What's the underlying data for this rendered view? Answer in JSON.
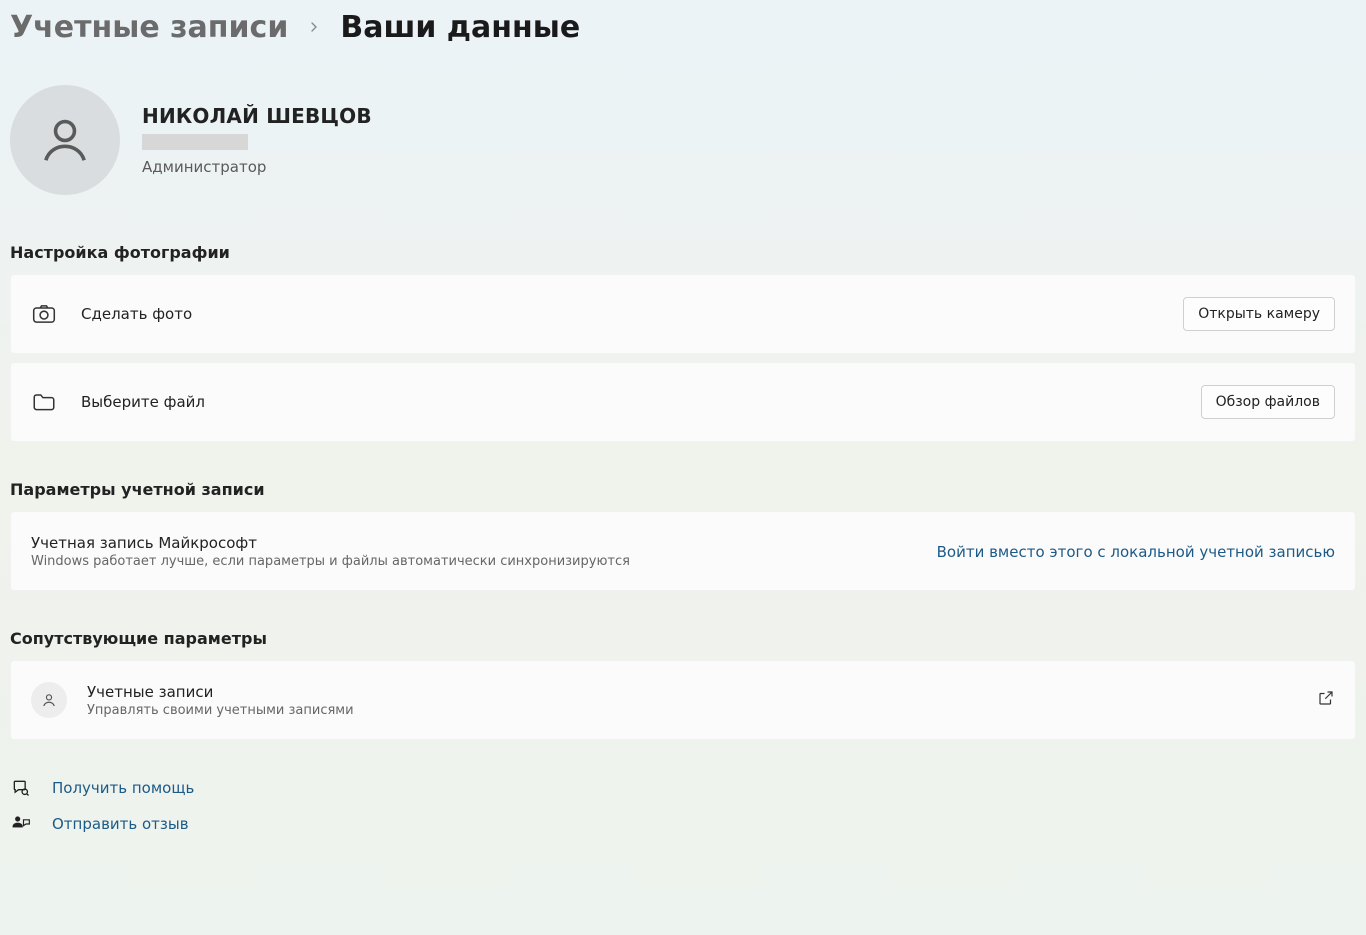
{
  "breadcrumb": {
    "parent": "Учетные записи",
    "current": "Ваши данные"
  },
  "profile": {
    "name": "НИКОЛАЙ ШЕВЦОВ",
    "role": "Администратор"
  },
  "sections": {
    "photo": {
      "title": "Настройка фотографии",
      "take_photo_label": "Сделать фото",
      "open_camera_button": "Открыть камеру",
      "choose_file_label": "Выберите файл",
      "browse_files_button": "Обзор файлов"
    },
    "account": {
      "title": "Параметры учетной записи",
      "ms_account_title": "Учетная запись Майкрософт",
      "ms_account_subtitle": "Windows работает лучше, если параметры и файлы автоматически синхронизируются",
      "sign_in_local_link": "Войти вместо этого с локальной учетной записью"
    },
    "related": {
      "title": "Сопутствующие параметры",
      "accounts_title": "Учетные записи",
      "accounts_subtitle": "Управлять своими учетными записями"
    }
  },
  "footer": {
    "get_help": "Получить помощь",
    "send_feedback": "Отправить отзыв"
  }
}
